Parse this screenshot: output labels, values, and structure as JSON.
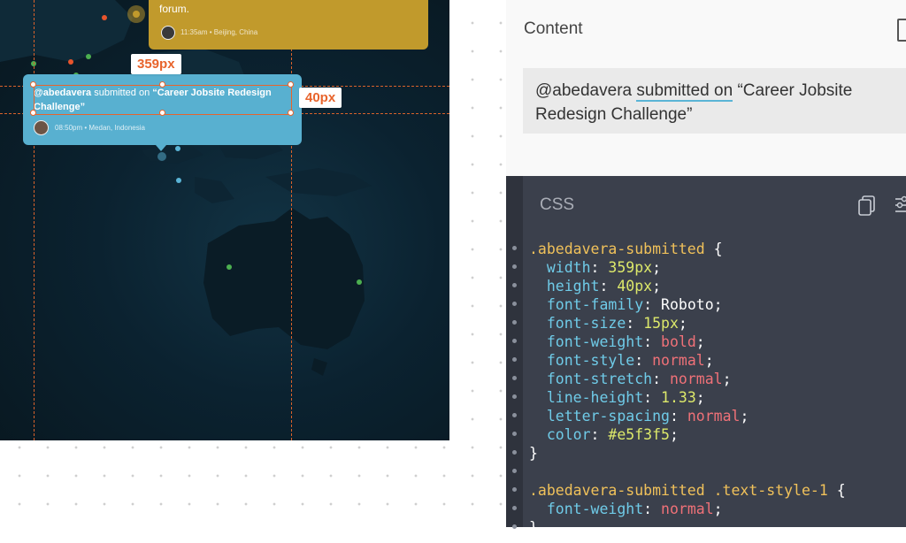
{
  "canvas": {
    "yellow_card": {
      "text": "forum.",
      "meta": "11:35am • Beijing, China"
    },
    "blue_card": {
      "user": "@abedavera",
      "text_mid": " submitted on ",
      "text_title": "“Career Jobsite Redesign Challenge”",
      "meta": "08:50pm • Medan, Indonesia"
    },
    "width_badge": "359px",
    "height_badge": "40px"
  },
  "content_panel": {
    "title": "Content",
    "user": "@abedavera",
    "link_text": "submitted on",
    "title_text": "“Career Jobsite Redesign Challenge”"
  },
  "css_panel": {
    "title": "CSS",
    "lines": {
      "l1_sel": ".abedavera-submitted",
      "l1_brace": " {",
      "width_val": "359px",
      "height_val": "40px",
      "font_family_val": "Roboto",
      "font_size_val": "15px",
      "font_weight_val": "bold",
      "font_style_val": "normal",
      "font_stretch_val": "normal",
      "line_height_val": "1.33",
      "letter_spacing_val": "normal",
      "color_val": "#e5f3f5",
      "sel2": ".abedavera-submitted .text-style-1",
      "fw2_val": "normal"
    }
  },
  "colors": {
    "accent_orange": "#e8642c",
    "card_blue": "#58b0d0",
    "card_yellow": "#c19a2c",
    "code_bg": "#3b404c"
  }
}
